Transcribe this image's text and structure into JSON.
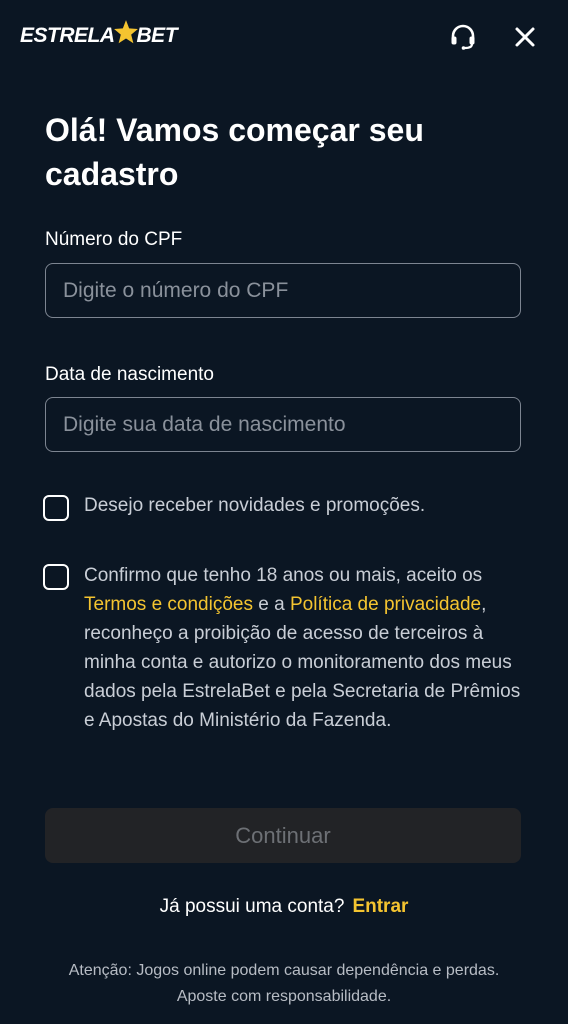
{
  "header": {
    "logo_left": "ESTRELA",
    "logo_right": "BET",
    "support_icon": "headset-icon",
    "close_icon": "close-icon"
  },
  "title": "Olá! Vamos começar seu cadastro",
  "cpf": {
    "label": "Número do CPF",
    "placeholder": "Digite o número do CPF",
    "value": ""
  },
  "birth": {
    "label": "Data de nascimento",
    "placeholder": "Digite sua data de nascimento",
    "value": ""
  },
  "newsletter": {
    "checked": false,
    "label": "Desejo receber novidades e promoções."
  },
  "terms": {
    "checked": false,
    "text_1": "Confirmo que tenho 18 anos ou mais, aceito os ",
    "link_terms": "Termos e condições",
    "text_2": " e a ",
    "link_privacy": "Política de privacidade",
    "text_3": ", reconheço a proibição de acesso de terceiros à minha conta e autorizo o monitoramento dos meus dados pela EstrelaBet e pela Secretaria de Prêmios e Apostas do Ministério da Fazenda."
  },
  "continue_label": "Continuar",
  "login": {
    "question": "Já possui uma conta?",
    "link": "Entrar"
  },
  "warning": "Atenção: Jogos online podem causar dependência e perdas. Aposte com responsabilidade.",
  "colors": {
    "background": "#0b1623",
    "accent": "#f4c430",
    "button_disabled": "#222326"
  }
}
